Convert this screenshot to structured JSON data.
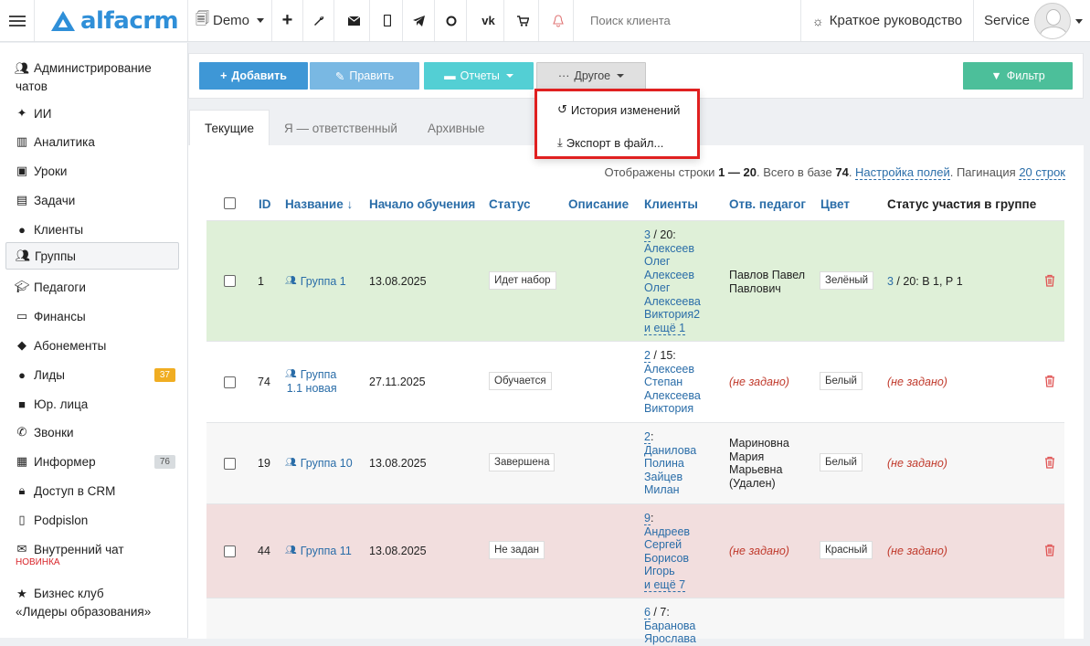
{
  "topbar": {
    "logo": "alfacrm",
    "branch": "Demo",
    "search_placeholder": "Поиск клиента",
    "guide": "Краткое руководство",
    "user": "Service"
  },
  "sidebar": {
    "items": [
      {
        "label": "Администрирование",
        "label2": "чатов"
      },
      {
        "label": "ИИ"
      },
      {
        "label": "Аналитика"
      },
      {
        "label": "Уроки"
      },
      {
        "label": "Задачи"
      },
      {
        "label": "Клиенты"
      },
      {
        "label": "Группы"
      },
      {
        "label": "Педагоги"
      },
      {
        "label": "Финансы"
      },
      {
        "label": "Абонементы"
      },
      {
        "label": "Лиды",
        "badge": "37"
      },
      {
        "label": "Юр. лица"
      },
      {
        "label": "Звонки"
      },
      {
        "label": "Информер",
        "badge": "76"
      },
      {
        "label": "Доступ в CRM"
      },
      {
        "label": "Podpislon"
      },
      {
        "label": "Внутренний чат",
        "tag": "НОВИНКА"
      },
      {
        "label": "Бизнес клуб",
        "label2": "«Лидеры образования»"
      }
    ]
  },
  "toolbar": {
    "add": "Добавить",
    "edit": "Править",
    "reports": "Отчеты",
    "other": "Другое",
    "filter": "Фильтр"
  },
  "dropdown": {
    "history": "История изменений",
    "export": "Экспорт в файл..."
  },
  "tabs": {
    "current": "Текущие",
    "mine": "Я — ответственный",
    "archive": "Архивные"
  },
  "info": {
    "shown_prefix": "Отображены строки",
    "range": "1 — 20",
    "total_prefix": ". Всего в базе",
    "total": "74",
    "fields_link": "Настройка полей",
    "pagination_prefix": ". Пагинация",
    "pagination_link": "20 строк"
  },
  "columns": {
    "id": "ID",
    "name": "Название ↓",
    "start": "Начало обучения",
    "status": "Статус",
    "description": "Описание",
    "clients": "Клиенты",
    "teacher": "Отв. педагог",
    "color": "Цвет",
    "participation": "Статус участия в группе"
  },
  "rows": [
    {
      "id": "1",
      "name": "Группа 1",
      "name2": "",
      "start": "13.08.2025",
      "status": "Идет набор",
      "clients_count": "3",
      "clients_total": " / 20:",
      "clients": [
        "Алексеев",
        "Олег",
        "Алексеев",
        "Олег",
        "Алексеева",
        "Виктория2"
      ],
      "more": "и ещё 1",
      "teacher": [
        "Павлов Павел",
        "Павлович"
      ],
      "color": "Зелёный",
      "part_count": "3",
      "participation": " / 20:  В 1, Р 1"
    },
    {
      "id": "74",
      "name": "Группа",
      "name2": "1.1 новая",
      "start": "27.11.2025",
      "status": "Обучается",
      "clients_count": "2",
      "clients_total": " / 15:",
      "clients": [
        "Алексеев",
        "Степан",
        "Алексеева",
        "Виктория"
      ],
      "more": "",
      "teacher_notset": "(не задано)",
      "color": "Белый",
      "participation_notset": "(не задано)"
    },
    {
      "id": "19",
      "name": "Группа 10",
      "name2": "",
      "start": "13.08.2025",
      "status": "Завершена",
      "clients_count": "2",
      "clients_total": ":",
      "clients": [
        "Данилова",
        "Полина",
        "Зайцев",
        "Милан"
      ],
      "more": "",
      "teacher": [
        "Мариновна",
        "Мария",
        "Марьевна",
        "(Удален)"
      ],
      "color": "Белый",
      "participation_notset": "(не задано)"
    },
    {
      "id": "44",
      "name": "Группа 11",
      "name2": "",
      "start": "13.08.2025",
      "status": "Не задан",
      "clients_count": "9",
      "clients_total": ":",
      "clients": [
        "Андреев",
        "Сергей",
        "Борисов",
        "Игорь"
      ],
      "more": "и ещё 7",
      "teacher_notset": "(не задано)",
      "color": "Красный",
      "participation_notset": "(не задано)"
    },
    {
      "clients_count": "6",
      "clients_total": " / 7:",
      "clients": [
        "Баранова",
        "Ярослава"
      ]
    }
  ],
  "colors": {
    "row_green": "#dff0d8",
    "row_red": "#f2dede",
    "row_gray": "#f7f7f7",
    "link": "#2a6da8",
    "accent": "#3e97d6"
  }
}
